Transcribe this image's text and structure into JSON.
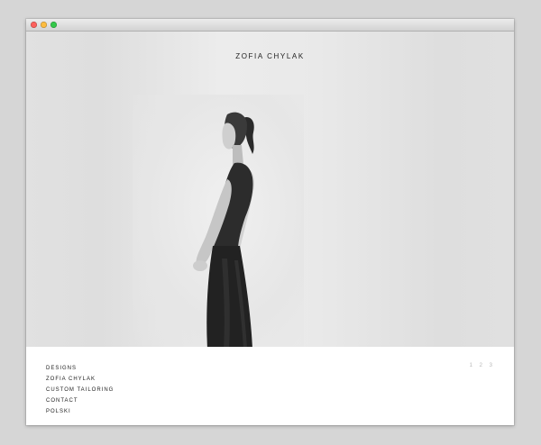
{
  "site": {
    "brand": "ZOFIA CHYLAK"
  },
  "hero": {
    "image": "fashion-model-black-dress"
  },
  "nav": {
    "items": [
      "DESIGNS",
      "ZOFIA CHYLAK",
      "CUSTOM TAILORING",
      "CONTACT",
      "POLSKI"
    ]
  },
  "pager": {
    "pages": [
      "1",
      "2",
      "3"
    ]
  },
  "colors": {
    "window_close": "#fc605c",
    "window_minimize": "#fdbc40",
    "window_zoom": "#34c84a",
    "text": "#222222",
    "pager": "#b8b8b8"
  }
}
